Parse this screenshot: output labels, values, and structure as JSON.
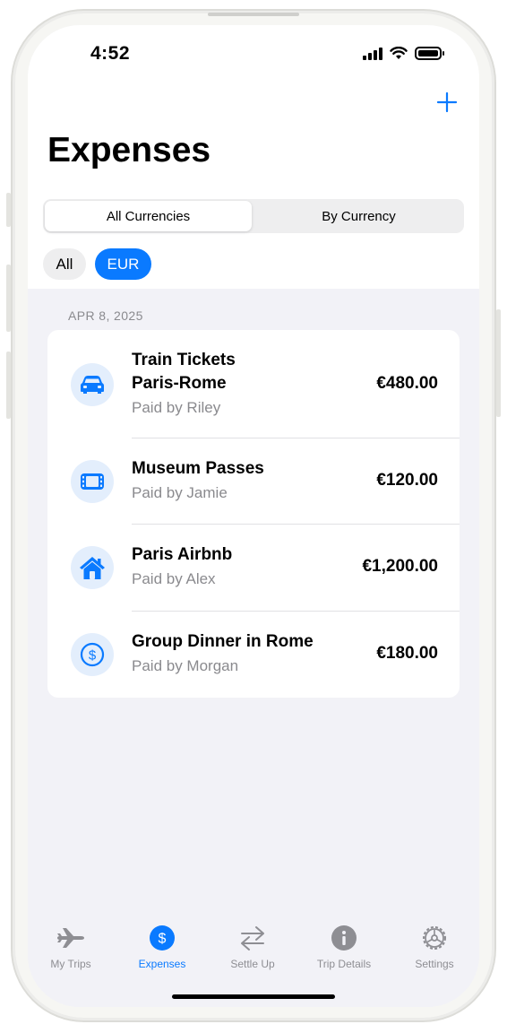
{
  "status_bar": {
    "time": "4:52"
  },
  "header": {
    "title": "Expenses",
    "add_icon": "plus-icon"
  },
  "segmented": {
    "options": [
      "All Currencies",
      "By Currency"
    ],
    "selected": "All Currencies"
  },
  "filters": {
    "chips": [
      "All",
      "EUR"
    ],
    "selected": "EUR"
  },
  "section": {
    "date": "APR 8, 2025"
  },
  "expenses": [
    {
      "title_line1": "Train Tickets",
      "title_line2": "Paris-Rome",
      "paid_by": "Paid by Riley",
      "amount": "€480.00",
      "icon": "car-icon"
    },
    {
      "title": "Museum Passes",
      "paid_by": "Paid by Jamie",
      "amount": "€120.00",
      "icon": "ticket-icon"
    },
    {
      "title": "Paris Airbnb",
      "paid_by": "Paid by Alex",
      "amount": "€1,200.00",
      "icon": "house-icon"
    },
    {
      "title": "Group Dinner in Rome",
      "paid_by": "Paid by Morgan",
      "amount": "€180.00",
      "icon": "dollar-circle-icon"
    }
  ],
  "tabbar": {
    "tabs": [
      {
        "label": "My Trips",
        "icon": "airplane-icon"
      },
      {
        "label": "Expenses",
        "icon": "dollar-circle-icon"
      },
      {
        "label": "Settle Up",
        "icon": "arrows-left-right-icon"
      },
      {
        "label": "Trip Details",
        "icon": "info-circle-icon"
      },
      {
        "label": "Settings",
        "icon": "gear-icon"
      }
    ],
    "active": "Expenses"
  },
  "colors": {
    "accent": "#0a7aff",
    "background": "#f2f2f7",
    "secondary_text": "#8a8a8e",
    "icon_bg": "#e3eefc"
  }
}
